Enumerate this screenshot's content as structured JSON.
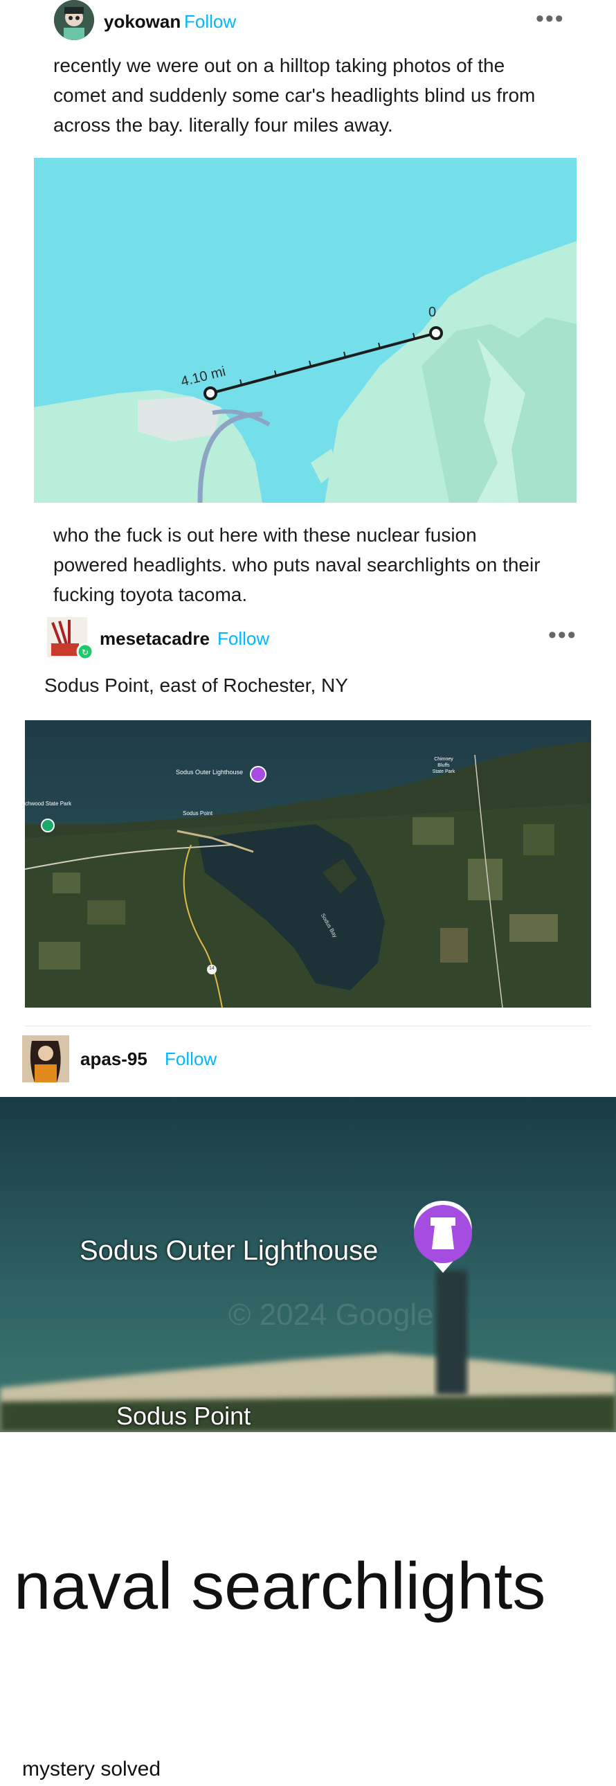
{
  "post1": {
    "username": "yokowan",
    "follow": "Follow",
    "more": "•••",
    "text": "recently we were out on a hilltop taking photos of the comet and suddenly some car's headlights blind us from across the bay. literally four miles away.",
    "map": {
      "distance_label": "4.10 mi",
      "start_label": "0"
    },
    "text2": "who the fuck is out here with these nuclear fusion powered headlights. who puts naval searchlights on their fucking toyota tacoma."
  },
  "post2": {
    "username": "mesetacadre",
    "follow": "Follow",
    "more": "•••",
    "text": "Sodus Point, east of Rochester, NY",
    "map": {
      "lighthouse_label": "Sodus Outer Lighthouse",
      "point_label": "Sodus Point",
      "park_label": "chwood State Park",
      "bluffs_label": [
        "Chimney",
        "Bluffs",
        "State Park"
      ],
      "bay_label": "Sodus Bay",
      "road_label": "14"
    }
  },
  "post3": {
    "username": "apas-95",
    "follow": "Follow",
    "zoom": {
      "lighthouse_label": "Sodus Outer Lighthouse",
      "point_label": "Sodus Point",
      "watermark": "© 2024 Google"
    },
    "meme_text": "naval searchlights",
    "caption": "mystery solved"
  },
  "colors": {
    "follow": "#00b8ff",
    "water_light": "#74dfeb",
    "land_light": "#b9eedb",
    "pin": "#a44de0"
  }
}
